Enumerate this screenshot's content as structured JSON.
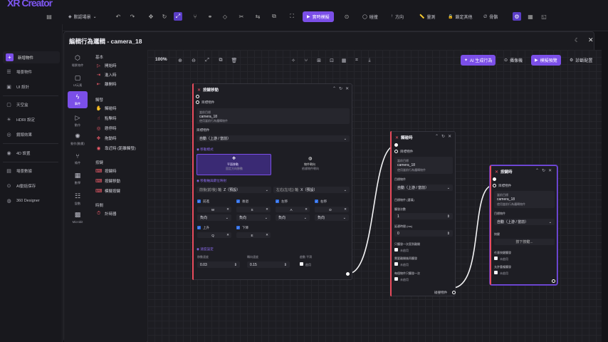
{
  "topbar": {
    "logo": "XR Creator",
    "scene_label": "默認場景",
    "preview_label": "實時模擬",
    "collide_label": "碰撞",
    "direction_label": "方向",
    "measure_label": "量測",
    "lock_label": "鎖定其他",
    "bone_label": "骨骼"
  },
  "sidebar": {
    "add_label": "新增物件",
    "items": [
      {
        "icon": "list",
        "label": "場景物件"
      },
      {
        "icon": "ui",
        "label": "UI 設計"
      },
      {
        "icon": "sky",
        "label": "天空盒"
      },
      {
        "icon": "hdri",
        "label": "HDRI 設定"
      },
      {
        "icon": "fx",
        "label": "鏡頭效果"
      },
      {
        "icon": "4d",
        "label": "4D 設置"
      },
      {
        "icon": "save",
        "label": "場景數據"
      },
      {
        "icon": "ai",
        "label": "AI動話保存"
      },
      {
        "icon": "360",
        "label": "360 Designer"
      }
    ]
  },
  "modal": {
    "title": "編輯行為邏輯 - camera_18",
    "categories": [
      {
        "label": "場景物件"
      },
      {
        "label": "UI元素"
      },
      {
        "label": "事件"
      },
      {
        "label": "動作"
      },
      {
        "label": "動作(動畫)"
      },
      {
        "label": "條件"
      },
      {
        "label": "數學"
      },
      {
        "label": "變數"
      },
      {
        "label": "Microbit"
      }
    ],
    "groups": [
      {
        "title": "基本",
        "items": [
          "開始時",
          "進入時",
          "離開時"
        ]
      },
      {
        "title": "觸發",
        "items": [
          "觸碰時",
          "點擊時",
          "懸停時",
          "拖動時",
          "靠近時 (距離觸發)"
        ]
      },
      {
        "title": "按鍵",
        "items": [
          "按鍵時",
          "按鍵移動",
          "模擬按鍵"
        ]
      },
      {
        "title": "時間",
        "items": [
          "計時器"
        ]
      }
    ]
  },
  "canvas_toolbar": {
    "zoom": "100%",
    "ai_label": "AI 生成行為",
    "camera_label": "攝像機",
    "template_label": "模擬預覽",
    "diag_label": "診斷配置"
  },
  "node_move": {
    "title": "按鍵移動",
    "target_label": "目標物件",
    "current_target_label": "當前目標",
    "current_target_value": "camera_18",
    "current_target_hint": "使用當前行為邏輯物件",
    "object_label": "目標物件",
    "object_value": "自動（上游 / 當前）",
    "mode_label": "移動模式",
    "mode_a_title": "平面移動",
    "mode_a_hint": "固定方向移動",
    "mode_b_title": "物件朝向",
    "mode_b_hint": "依據物件朝向",
    "axis_label": "移動軸與鍵位映射",
    "fb_label": "前後(前/後) 軸",
    "fb_value": "Z（預設）",
    "lr_label": "左右(左/右) 軸",
    "lr_value": "X（預設）",
    "keys": [
      {
        "label": "前進",
        "key": "W"
      },
      {
        "label": "後退",
        "key": "S"
      },
      {
        "label": "左移",
        "key": "A"
      },
      {
        "label": "右移",
        "key": "D"
      }
    ],
    "dirs": [
      "負向",
      "負向",
      "負向",
      "負向"
    ],
    "up_label": "上升",
    "up_key": "Q",
    "down_label": "下降",
    "down_key": "E",
    "speed_section": "速度設定",
    "speed_label": "移動速度",
    "speed_value": "0.03",
    "rot_label": "轉向速度",
    "rot_value": "0.15",
    "smooth_label": "啟動 平滑",
    "smooth_check": "啟用"
  },
  "node_click": {
    "title": "觸碰時",
    "target_label": "目標物件",
    "current_label": "當前目標",
    "current_value": "camera_18",
    "current_hint": "使用當前行為邏輯物件",
    "object_label": "目標物件",
    "object_value": "自動（上游 / 當前）",
    "pick_label": "目標物件 (選填)",
    "count_label": "觸發次數",
    "count_value": "1",
    "delay_label": "延遲時間 (ms)",
    "delay_value": "0",
    "once_label": "只觸發一次直到離開",
    "once_check": "未啟用",
    "require_label": "需要離開後再觸發",
    "require_check": "未啟用",
    "each_label": "每個物件只觸發一次",
    "each_check": "未啟用",
    "out_label": "碰撞物件"
  },
  "node_key": {
    "title": "按鍵時",
    "target_label": "目標物件",
    "current_label": "當前目標",
    "current_value": "camera_18",
    "current_hint": "使用當前行為邏輯物件",
    "object_label": "目標物件",
    "object_value": "自動（上游 / 當前）",
    "key_label": "按鍵",
    "key_value": "按下按鍵...",
    "hold_label": "任意按鍵觸發",
    "hold_check": "未啟用",
    "repeat_label": "允許重複觸發",
    "repeat_check": "未啟用"
  }
}
